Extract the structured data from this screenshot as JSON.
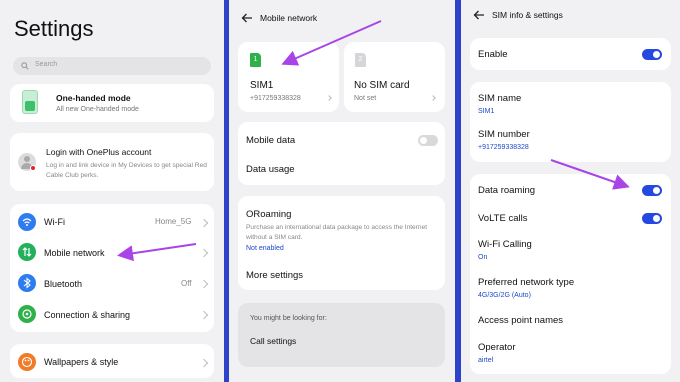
{
  "colors": {
    "accent": "#2549e0",
    "arrow": "#a844e8",
    "divider": "#2d44c9",
    "wifi": "#2d7cf0",
    "mobile": "#23b05a",
    "bluetooth": "#2d7cf0",
    "sharing": "#2fb14a",
    "wallpaper": "#f07c2a"
  },
  "settings": {
    "title": "Settings",
    "search_placeholder": "Search",
    "one_handed": {
      "title": "One-handed mode",
      "subtitle": "All new One-handed mode"
    },
    "oneplus": {
      "title": "Login with OnePlus account",
      "subtitle": "Log in and link device in My Devices to get special Red Cable Club perks."
    },
    "items": [
      {
        "label": "Wi-Fi",
        "value": "Home_5G",
        "icon": "wifi-icon"
      },
      {
        "label": "Mobile network",
        "value": "",
        "icon": "mobile-network-icon"
      },
      {
        "label": "Bluetooth",
        "value": "Off",
        "icon": "bluetooth-icon"
      },
      {
        "label": "Connection & sharing",
        "value": "",
        "icon": "connection-sharing-icon"
      }
    ],
    "wallpapers": "Wallpapers & style"
  },
  "mobile_network": {
    "title": "Mobile network",
    "sim1": {
      "name": "SIM1",
      "number": "+917259338328",
      "badge": "1"
    },
    "sim2": {
      "name": "No SIM card",
      "status": "Not set"
    },
    "mobile_data": "Mobile data",
    "data_usage": "Data usage",
    "oroaming": {
      "title": "ORoaming",
      "description": "Purchase an international data package to access the Internet without a SIM card.",
      "status": "Not enabled"
    },
    "more_settings": "More settings",
    "looking_for": "You might be looking for:",
    "call_settings": "Call settings"
  },
  "sim_info": {
    "title": "SIM info & settings",
    "enable": "Enable",
    "sim_name_label": "SIM name",
    "sim_name_value": "SIM1",
    "sim_number_label": "SIM number",
    "sim_number_value": "+917259338328",
    "data_roaming": "Data roaming",
    "volte": "VoLTE calls",
    "wifi_calling": "Wi-Fi Calling",
    "wifi_calling_value": "On",
    "preferred_network": "Preferred network type",
    "preferred_network_value": "4G/3G/2G (Auto)",
    "apn": "Access point names",
    "operator": "Operator",
    "operator_value": "airtel"
  }
}
